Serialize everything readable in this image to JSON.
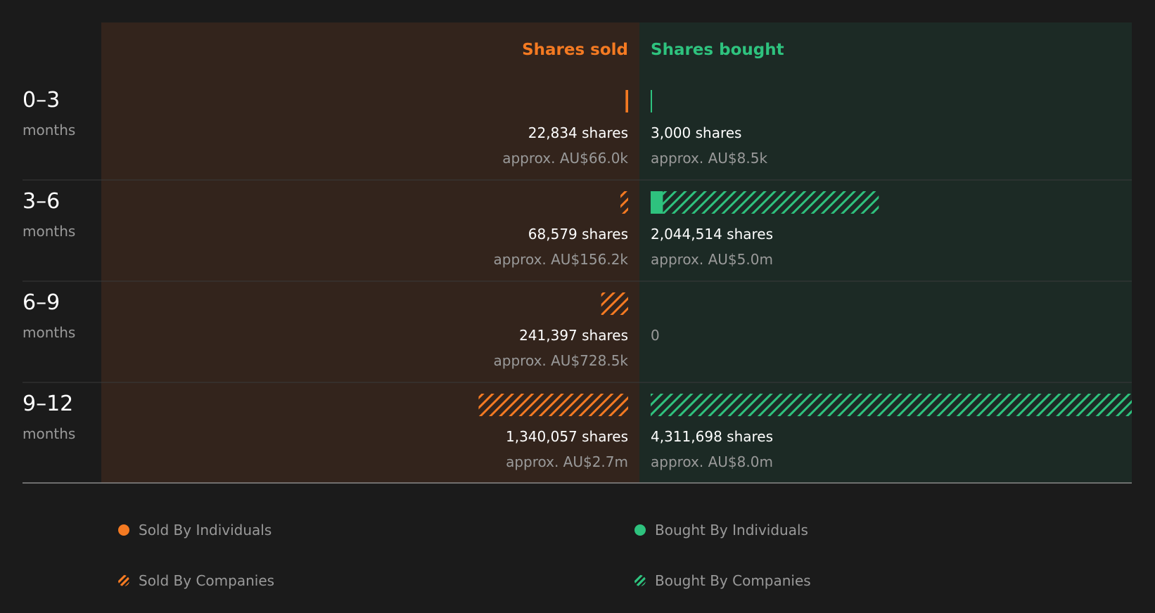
{
  "colors": {
    "background": "#1b1b1b",
    "sold_panel": "#33241c",
    "bought_panel": "#1c2a25",
    "sold": "#f47a22",
    "bought": "#2ec27e",
    "text": "#ffffff",
    "muted": "#9a9a9a",
    "divider": "#3a3a3a"
  },
  "chart_data": {
    "type": "bar",
    "layout": "diverging-horizontal",
    "columns": {
      "sold_label": "Shares sold",
      "bought_label": "Shares bought"
    },
    "categories": [
      {
        "period": "0–3",
        "unit": "months"
      },
      {
        "period": "3–6",
        "unit": "months"
      },
      {
        "period": "6–9",
        "unit": "months"
      },
      {
        "period": "9–12",
        "unit": "months"
      }
    ],
    "series": [
      {
        "name": "Sold By Individuals",
        "side": "sold",
        "pattern": "solid",
        "values": [
          22834,
          0,
          0,
          0
        ]
      },
      {
        "name": "Sold By Companies",
        "side": "sold",
        "pattern": "hatched",
        "values": [
          0,
          68579,
          241397,
          1340057
        ]
      },
      {
        "name": "Bought By Individuals",
        "side": "bought",
        "pattern": "solid",
        "values": [
          3000,
          110000,
          0,
          0
        ]
      },
      {
        "name": "Bought By Companies",
        "side": "bought",
        "pattern": "hatched",
        "values": [
          0,
          1934514,
          0,
          4311698
        ]
      }
    ],
    "sold_labels": [
      {
        "shares": "22,834 shares",
        "value": "approx. AU$66.0k"
      },
      {
        "shares": "68,579 shares",
        "value": "approx. AU$156.2k"
      },
      {
        "shares": "241,397 shares",
        "value": "approx. AU$728.5k"
      },
      {
        "shares": "1,340,057 shares",
        "value": "approx. AU$2.7m"
      }
    ],
    "bought_labels": [
      {
        "shares": "3,000 shares",
        "value": "approx. AU$8.5k"
      },
      {
        "shares": "2,044,514 shares",
        "value": "approx. AU$5.0m"
      },
      {
        "shares": "0",
        "value": ""
      },
      {
        "shares": "4,311,698 shares",
        "value": "approx. AU$8.0m"
      }
    ],
    "legend": [
      "Sold By Individuals",
      "Bought By Individuals",
      "Sold By Companies",
      "Bought By Companies"
    ]
  }
}
